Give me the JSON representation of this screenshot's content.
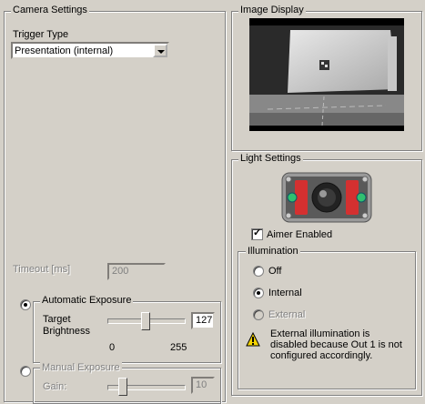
{
  "camera_settings": {
    "title": "Camera Settings",
    "trigger_type_label": "Trigger Type",
    "trigger_type_value": "Presentation (internal)",
    "timeout_label": "Timeout [ms]",
    "timeout_value": "200",
    "auto_exposure": {
      "title": "Automatic Exposure",
      "selected": true,
      "target_brightness_label_1": "Target",
      "target_brightness_label_2": "Brightness",
      "value": "127",
      "min_label": "0",
      "max_label": "255",
      "level_fraction": 0.498
    },
    "manual_exposure": {
      "title": "Manual Exposure",
      "selected": false,
      "gain_label": "Gain:",
      "gain_value": "10"
    }
  },
  "image_display": {
    "title": "Image Display"
  },
  "light_settings": {
    "title": "Light Settings",
    "aimer_label": "Aimer Enabled",
    "aimer_checked": true,
    "illumination": {
      "title": "Illumination",
      "options": [
        {
          "label": "Off",
          "selected": false,
          "enabled": true
        },
        {
          "label": "Internal",
          "selected": true,
          "enabled": true
        },
        {
          "label": "External",
          "selected": false,
          "enabled": false
        }
      ],
      "warning_text_1": "External illumination is",
      "warning_text_2": "disabled because Out 1 is not",
      "warning_text_3": "configured accordingly.",
      "warning_icon": "warning-icon"
    }
  }
}
